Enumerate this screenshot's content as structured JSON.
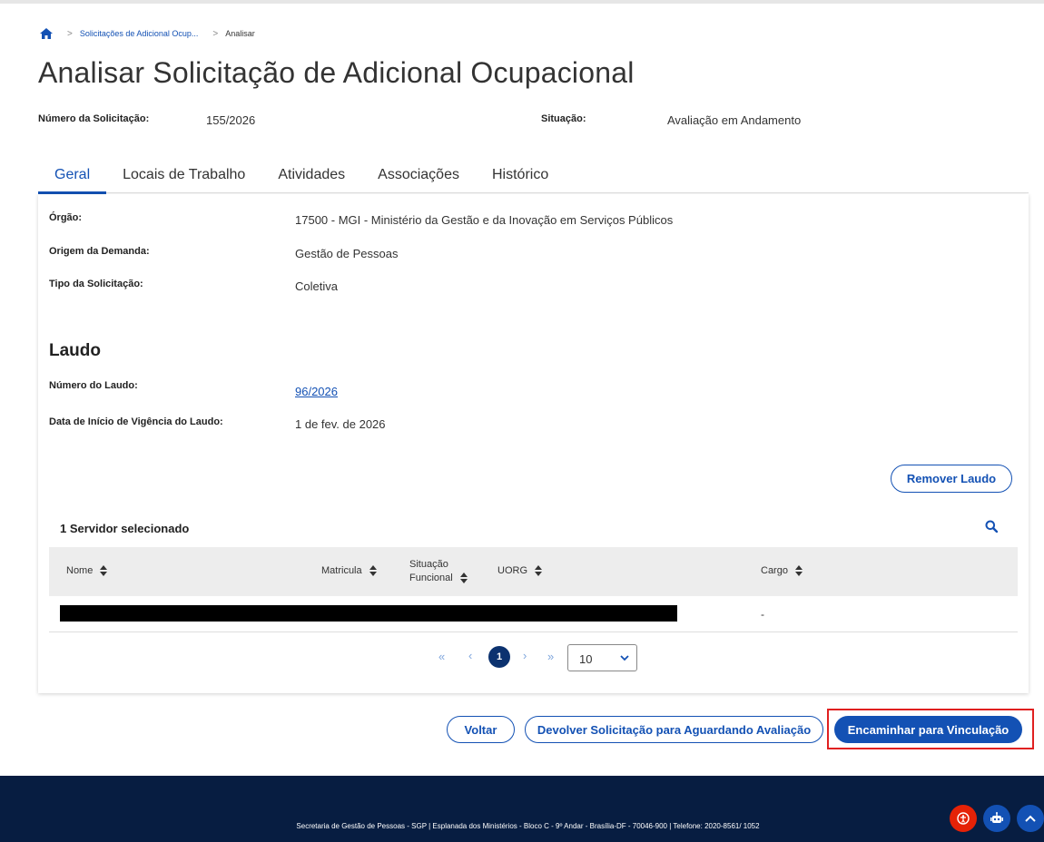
{
  "breadcrumb": {
    "home_icon": "home-icon",
    "items": [
      "Solicitações de Adicional Ocup...",
      "Analisar"
    ]
  },
  "page_title": "Analisar Solicitação de Adicional Ocupacional",
  "summary": {
    "numero_label": "Número da Solicitação:",
    "numero_value": "155/2026",
    "situacao_label": "Situação:",
    "situacao_value": "Avaliação em Andamento"
  },
  "tabs": [
    {
      "label": "Geral",
      "active": true
    },
    {
      "label": "Locais de Trabalho",
      "active": false
    },
    {
      "label": "Atividades",
      "active": false
    },
    {
      "label": "Associações",
      "active": false
    },
    {
      "label": "Histórico",
      "active": false
    }
  ],
  "geral": {
    "orgao_label": "Órgão:",
    "orgao_value": "17500 - MGI - Ministério da Gestão e da Inovação em Serviços Públicos",
    "origem_label": "Origem da Demanda:",
    "origem_value": "Gestão de Pessoas",
    "tipo_label": "Tipo da Solicitação:",
    "tipo_value": "Coletiva"
  },
  "laudo": {
    "title": "Laudo",
    "numero_label": "Número do Laudo:",
    "numero_value": "96/2026",
    "data_label": "Data de Início de Vigência do Laudo:",
    "data_value": "1 de fev. de 2026",
    "remove_button": "Remover Laudo"
  },
  "servidores": {
    "selected_text": "1 Servidor selecionado",
    "columns": {
      "nome": "Nome",
      "matricula": "Matricula",
      "situacao_l1": "Situação",
      "situacao_l2": "Funcional",
      "uorg": "UORG",
      "cargo": "Cargo"
    },
    "rows": [
      {
        "nome": "[redacted]",
        "cargo": "-"
      }
    ]
  },
  "pagination": {
    "first": "«",
    "prev": "‹",
    "current_page": "1",
    "next": "›",
    "last": "»",
    "page_size": "10"
  },
  "actions": {
    "voltar": "Voltar",
    "devolver": "Devolver Solicitação para Aguardando Avaliação",
    "encaminhar": "Encaminhar para Vinculação"
  },
  "footer": {
    "text": "Secretaria de Gestão de Pessoas - SGP | Esplanada dos Ministérios - Bloco C - 9º Andar - Brasília-DF - 70046-900 | Telefone: 2020-8561/ 1052"
  },
  "colors": {
    "primary": "#1351b4",
    "dark_blue": "#071d41",
    "highlight": "#e02020",
    "accessibility_red": "#e52207"
  }
}
